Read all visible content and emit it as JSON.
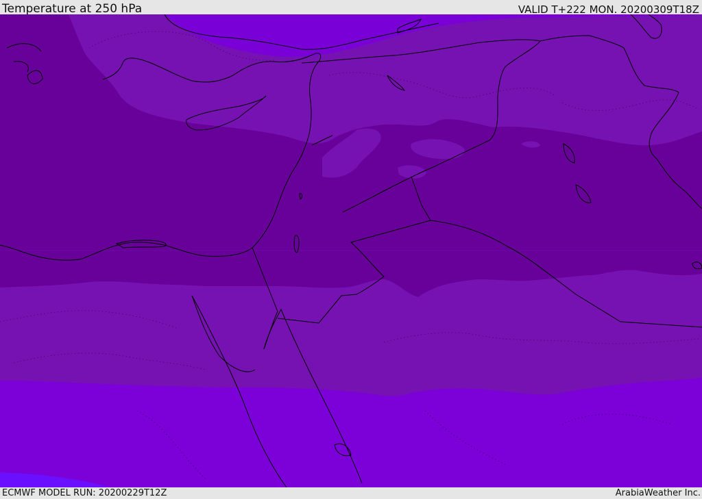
{
  "header": {
    "title": "Temperature at 250 hPa",
    "valid_time": "VALID T+222 MON. 20200309T18Z"
  },
  "footer": {
    "model_run": "ECMWF MODEL RUN: 20200229T12Z",
    "credit": "ArabiaWeather Inc."
  },
  "map": {
    "colors": {
      "band_north": "#7a00d8",
      "band_light": "#7712b2",
      "band_core": "#68009a",
      "band_south": "#7c00d8",
      "band_far_south": "#6a10ff",
      "coastline": "#000000",
      "border": "#000000"
    }
  }
}
